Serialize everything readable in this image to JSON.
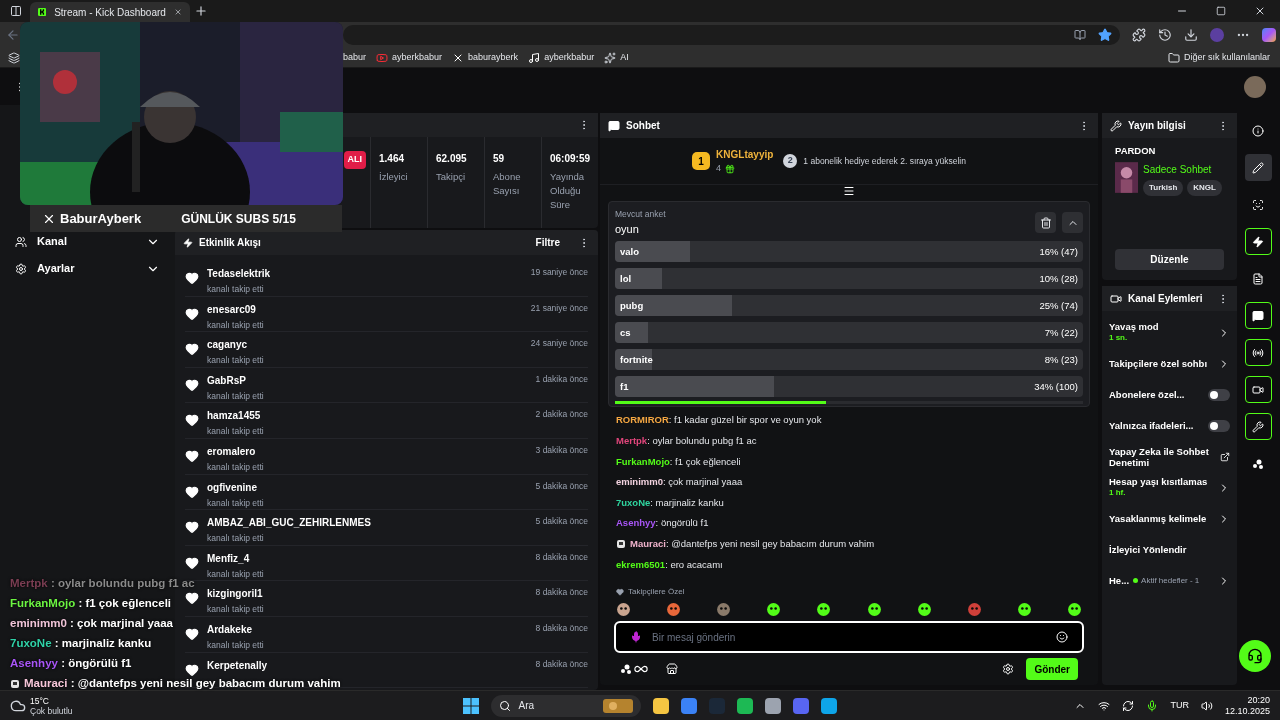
{
  "browser": {
    "tab_title": "Stream - Kick Dashboard",
    "bookmarks": [
      {
        "label": "babur"
      },
      {
        "label": "ayberkbabur"
      },
      {
        "label": "baburayberk"
      },
      {
        "label": "ayberkbabur"
      },
      {
        "label": "AI"
      }
    ],
    "other_bookmarks": "Diğer sık kullanılanlar"
  },
  "stream_overlay": {
    "kind": "picture",
    "handle": "BaburAyberk",
    "goal": "GÜNLÜK SUBS 5/15"
  },
  "overlay_chat": [
    {
      "user": "Mertpk",
      "text": ": oylar bolundu pubg f1 ac",
      "color": "#7a3d52",
      "faded": true,
      "badge": false
    },
    {
      "user": "FurkanMojo",
      "text": ": f1 çok eğlenceli",
      "color": "#6cf542",
      "faded": false,
      "badge": false
    },
    {
      "user": "eminimm0",
      "text": ": çok marjinal yaaa",
      "color": "#f0c4d8",
      "faded": false,
      "badge": false
    },
    {
      "user": "7uxoNe",
      "text": ": marjinaliz kanku",
      "color": "#2fd3a8",
      "faded": false,
      "badge": false
    },
    {
      "user": "Asenhyy",
      "text": ": öngörülü f1",
      "color": "#a855f7",
      "faded": false,
      "badge": false
    },
    {
      "user": "Mauraci",
      "text": ": @dantefps yeni nesil gey babacım durum vahim",
      "color": "#f7c6d9",
      "faded": false,
      "badge": true
    }
  ],
  "sidebar": {
    "items": [
      {
        "label": "Kanal",
        "expanded": false
      },
      {
        "label": "Ayarlar",
        "expanded": false
      }
    ]
  },
  "stats": {
    "badge": "ALI",
    "items": [
      {
        "value": "1.464",
        "label": "İzleyici"
      },
      {
        "value": "62.095",
        "label": "Takipçi"
      },
      {
        "value": "59",
        "label": "Abone Sayısı"
      },
      {
        "value": "06:09:59",
        "label": "Yayında Olduğu Süre"
      }
    ]
  },
  "activity": {
    "title": "Etkinlik Akışı",
    "filter": "Filtre",
    "events": [
      {
        "user": "Tedaselektrik",
        "action": "kanalı takip etti",
        "time": "19 saniye önce"
      },
      {
        "user": "enesarc09",
        "action": "kanalı takip etti",
        "time": "21 saniye önce"
      },
      {
        "user": "caganyc",
        "action": "kanalı takip etti",
        "time": "24 saniye önce"
      },
      {
        "user": "GabRsP",
        "action": "kanalı takip etti",
        "time": "1 dakika önce"
      },
      {
        "user": "hamza1455",
        "action": "kanalı takip etti",
        "time": "2 dakika önce"
      },
      {
        "user": "eromalero",
        "action": "kanalı takip etti",
        "time": "3 dakika önce"
      },
      {
        "user": "ogfivenine",
        "action": "kanalı takip etti",
        "time": "5 dakika önce"
      },
      {
        "user": "AMBAZ_ABI_GUC_ZEHIRLENMES",
        "action": "kanalı takip etti",
        "time": "5 dakika önce"
      },
      {
        "user": "Menfiz_4",
        "action": "kanalı takip etti",
        "time": "8 dakika önce"
      },
      {
        "user": "kizgingoril1",
        "action": "kanalı takip etti",
        "time": "8 dakika önce"
      },
      {
        "user": "Ardakeke",
        "action": "kanalı takip etti",
        "time": "8 dakika önce"
      },
      {
        "user": "Kerpetenally",
        "time": "8 dakika önce"
      }
    ]
  },
  "chat": {
    "title": "Sohbet",
    "leader": {
      "rank": "1",
      "name": "KNGLtayyip",
      "count": "4",
      "next_rank": "2",
      "hint": "1 abonelik hediye ederek 2. sıraya yükselin"
    },
    "poll": {
      "label": "Mevcut anket",
      "question": "oyun",
      "level": 0.45,
      "options": [
        {
          "label": "valo",
          "level": 0.16,
          "result": "16% (47)"
        },
        {
          "label": "lol",
          "level": 0.1,
          "result": "10% (28)"
        },
        {
          "label": "pubg",
          "level": 0.25,
          "result": "25% (74)"
        },
        {
          "label": "cs",
          "level": 0.07,
          "result": "7% (22)"
        },
        {
          "label": "fortnite",
          "level": 0.08,
          "result": "8% (23)"
        },
        {
          "label": "f1",
          "level": 0.34,
          "result": "34% (100)"
        }
      ]
    },
    "messages": [
      {
        "user": "RORMIROR",
        "text": ": f1 kadar güzel bir spor ve oyun yok",
        "color": "#f5a742",
        "badge": false
      },
      {
        "user": "Mertpk",
        "text": ": oylar bolundu pubg f1 ac",
        "color": "#e0457b",
        "badge": false
      },
      {
        "user": "FurkanMojo",
        "text": ": f1 çok eğlenceli",
        "color": "#53fc18",
        "badge": false
      },
      {
        "user": "eminimm0",
        "text": ": çok marjinal yaaa",
        "color": "#f3d3e0",
        "badge": false
      },
      {
        "user": "7uxoNe",
        "text": ": marjinaliz kanku",
        "color": "#2fd6a0",
        "badge": false
      },
      {
        "user": "Asenhyy",
        "text": ": öngörülü f1",
        "color": "#a855f7",
        "badge": false
      },
      {
        "user": "Mauraci",
        "text": ": @dantefps yeni nesil gey babacım durum vahim",
        "color": "#f0b3cc",
        "badge": true
      },
      {
        "user": "ekrem6501",
        "text": ": ero acacamı",
        "color": "#53fc18",
        "badge": false
      }
    ],
    "emotes_label": "Takipçilere Özel",
    "input": {
      "placeholder": "Bir mesaj gönderin"
    },
    "send": "Gönder"
  },
  "stream_info": {
    "title": "Yayın bilgisi",
    "stream_title": "PARDON",
    "category": "Sadece Sohbet",
    "tags": [
      "Turkish",
      "KNGL"
    ],
    "edit": "Düzenle"
  },
  "channel_actions": {
    "title": "Kanal Eylemleri",
    "items": [
      {
        "kind": "link",
        "label": "Yavaş mod",
        "value": "1 sn."
      },
      {
        "kind": "link",
        "label": "Takipçilere özel sohbı"
      },
      {
        "kind": "toggle",
        "label": "Abonelere özel...",
        "on": false
      },
      {
        "kind": "toggle",
        "label": "Yalnızca ifadeleri...",
        "on": false
      },
      {
        "kind": "external",
        "label": "Yapay Zeka ile Sohbet Denetimi"
      },
      {
        "kind": "link",
        "label": "Hesap yaşı kısıtlamas",
        "value": "1 hf."
      },
      {
        "kind": "link",
        "label": "Yasaklanmış kelimele"
      },
      {
        "kind": "plain",
        "label": "İzleyici Yönlendir"
      },
      {
        "kind": "goal",
        "label": "He...",
        "status": "Aktif hedefler - 1"
      }
    ]
  },
  "rail": [
    {
      "selected": false,
      "pinned": false
    },
    {
      "selected": true,
      "pinned": false
    },
    {
      "selected": false,
      "pinned": false
    },
    {
      "selected": false,
      "pinned": true
    },
    {
      "selected": false,
      "pinned": false
    },
    {
      "selected": false,
      "pinned": true
    },
    {
      "selected": false,
      "pinned": true
    },
    {
      "selected": false,
      "pinned": true
    },
    {
      "selected": false,
      "pinned": true
    },
    {
      "selected": false,
      "pinned": false
    }
  ],
  "taskbar": {
    "temperature": "15°C",
    "weather": "Çok bulutlu",
    "search": "Ara",
    "language": "TUR",
    "time": "20:20",
    "date": "12.10.2025"
  }
}
